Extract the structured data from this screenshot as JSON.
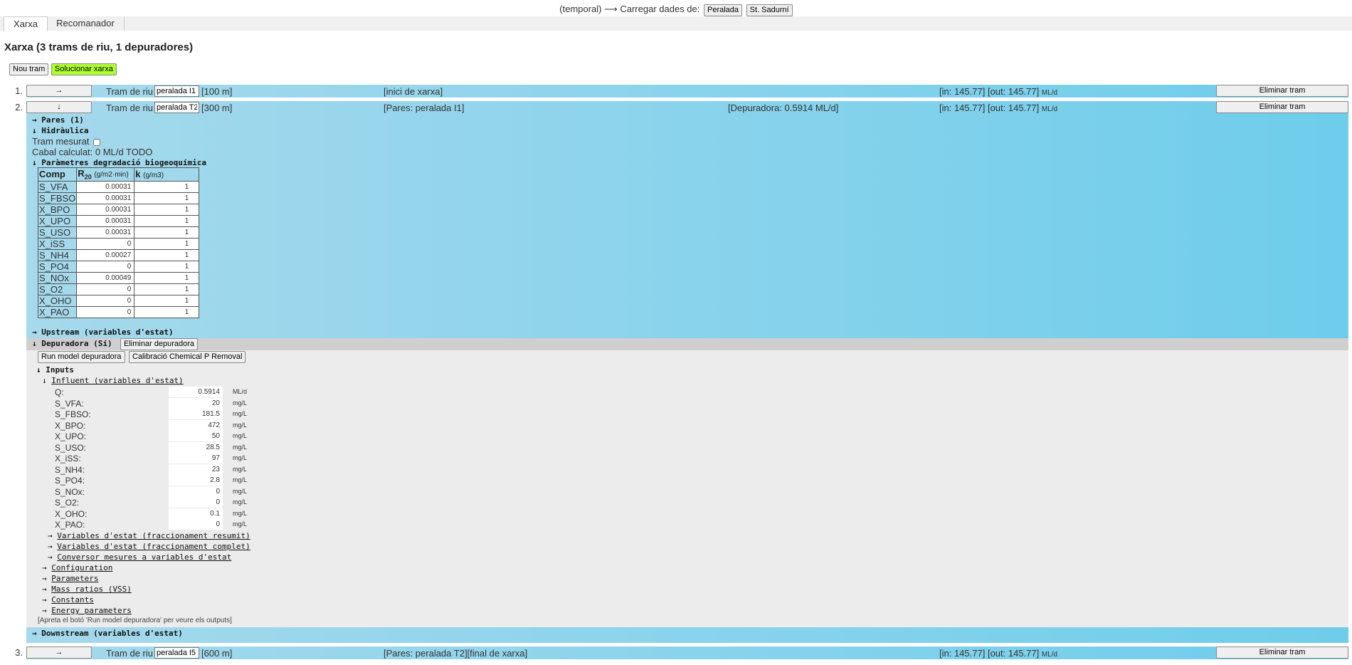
{
  "top": {
    "text": "(temporal) ⟶ Carregar dades de:",
    "btn1": "Peralada",
    "btn2": "St. Sadurní"
  },
  "tabs": [
    "Xarxa",
    "Recomanador"
  ],
  "title": "Xarxa (3 trams de riu, 1 depuradores)",
  "buttons": {
    "new": "Nou tram",
    "solve": "Solucionar xarxa"
  },
  "colors": {
    "green": "#adff2f",
    "blue_start": "#a6d9ec",
    "blue_end": "#6ecdeb",
    "grey": "#ececec"
  },
  "trams": [
    {
      "idx": "1.",
      "arrow": "→",
      "label": "Tram de riu",
      "name": "peralada I1",
      "len": "[100 m]",
      "info": "[inici de xarxa]",
      "dep": "",
      "in": "[in: 145.77]",
      "out": "[out: 145.77]",
      "unit": "ML/d",
      "remove": "Eliminar tram"
    },
    {
      "idx": "2.",
      "arrow": "↓",
      "label": "Tram de riu",
      "name": "peralada T2",
      "len": "[300 m]",
      "info": "[Pares: peralada I1]",
      "dep": "[Depuradora: 0.5914 ML/d]",
      "in": "[in: 145.77]",
      "out": "[out: 145.77]",
      "unit": "ML/d",
      "remove": "Eliminar tram"
    },
    {
      "idx": "3.",
      "arrow": "→",
      "label": "Tram de riu",
      "name": "peralada I5",
      "len": "[600 m]",
      "info": "[Pares: peralada T2][final de xarxa]",
      "dep": "",
      "in": "[in: 145.77]",
      "out": "[out: 145.77]",
      "unit": "ML/d",
      "remove": "Eliminar tram"
    }
  ],
  "panel": {
    "pares": "→ Pares (1)",
    "hidraulica": "↓ Hidràulica",
    "mesurat": "Tram mesurat",
    "cabal": "Cabal calculat: 0 ML/d TODO",
    "param": "↓ Paràmetres degradació biogeoquímica",
    "col_comp": "Comp",
    "col_r": "R",
    "col_r_sub": "20",
    "col_r_unit": "(g/m2·min)",
    "col_k": "k",
    "col_k_unit": "(g/m3)",
    "rows": [
      [
        "S_VFA",
        "0.00031",
        "1"
      ],
      [
        "S_FBSO",
        "0.00031",
        "1"
      ],
      [
        "X_BPO",
        "0.00031",
        "1"
      ],
      [
        "X_UPO",
        "0.00031",
        "1"
      ],
      [
        "S_USO",
        "0.00031",
        "1"
      ],
      [
        "X_iSS",
        "0",
        "1"
      ],
      [
        "S_NH4",
        "0.00027",
        "1"
      ],
      [
        "S_PO4",
        "0",
        "1"
      ],
      [
        "S_NOx",
        "0.00049",
        "1"
      ],
      [
        "S_O2",
        "0",
        "1"
      ],
      [
        "X_OHO",
        "0",
        "1"
      ],
      [
        "X_PAO",
        "0",
        "1"
      ]
    ],
    "upstream": "→ Upstream (variables d'estat)",
    "depuradora": "↓ Depuradora (Sí)",
    "elim_dep": "Eliminar depuradora",
    "run": "Run model depuradora",
    "calib": "Calibració Chemical P Removal",
    "inputs": "↓ Inputs",
    "influent_arrow": "↓",
    "influent": "Influent (variables d'estat)",
    "influent_rows": [
      [
        "Q:",
        "0.5914",
        "ML/d"
      ],
      [
        "S_VFA:",
        "20",
        "mg/L"
      ],
      [
        "S_FBSO:",
        "181.5",
        "mg/L"
      ],
      [
        "X_BPO:",
        "472",
        "mg/L"
      ],
      [
        "X_UPO:",
        "50",
        "mg/L"
      ],
      [
        "S_USO:",
        "28.5",
        "mg/L"
      ],
      [
        "X_iSS:",
        "97",
        "mg/L"
      ],
      [
        "S_NH4:",
        "23",
        "mg/L"
      ],
      [
        "S_PO4:",
        "2.8",
        "mg/L"
      ],
      [
        "S_NOx:",
        "0",
        "mg/L"
      ],
      [
        "S_O2:",
        "0",
        "mg/L"
      ],
      [
        "X_OHO:",
        "0.1",
        "mg/L"
      ],
      [
        "X_PAO:",
        "0",
        "mg/L"
      ]
    ],
    "sublinks": [
      "Variables d'estat (fraccionament resumit)",
      "Variables d'estat (fraccionament complet)",
      "Conversor mesures a variables d'estat"
    ],
    "links": [
      "Configuration",
      "Parameters",
      "Mass ratios (VSS)",
      "Constants",
      "Energy parameters"
    ],
    "note": "[Apreta el botó 'Run model depuradora' per veure els outputs]",
    "downstream": "→ Downstream (variables d'estat)"
  }
}
